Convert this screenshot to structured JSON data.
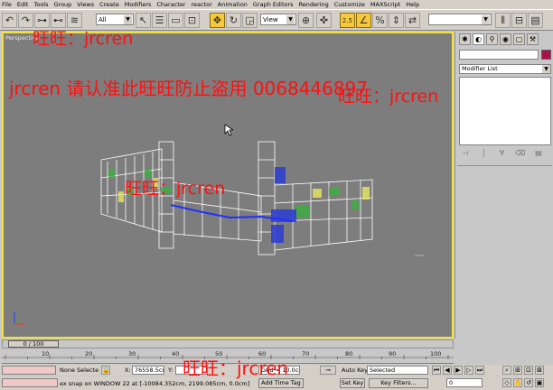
{
  "menu": [
    "File",
    "Edit",
    "Tools",
    "Group",
    "Views",
    "Create",
    "Modifiers",
    "Character",
    "reactor",
    "Animation",
    "Graph Editors",
    "Rendering",
    "Customize",
    "MAXScript",
    "Help"
  ],
  "toolbar": {
    "filter_value": "All",
    "coord_value": "View",
    "snap_label": "2.5"
  },
  "viewport": {
    "label": "Perspective"
  },
  "command_panel": {
    "modifier_list_placeholder": "Modifier List"
  },
  "timeline": {
    "frame_display": "0 / 100",
    "ticks": [
      "10",
      "20",
      "30",
      "40",
      "50",
      "60",
      "70",
      "80",
      "90",
      "100"
    ]
  },
  "status": {
    "selection": "None Selecte",
    "x_label": "X:",
    "x_value": "76558.5cm",
    "y_label": "Y:",
    "grid": "Grid = 10.0cm",
    "auto_key": "Auto Key",
    "selected": "Selected",
    "prompt": "ex snap on WINDOW 22 at [-10084.352cm, 2199.085cm, 0.0cm]",
    "add_time_tag": "Add Time Tag",
    "set_key": "Set Key",
    "key_filters": "Key Filters...",
    "frame_value": "0"
  },
  "watermarks": {
    "w1": "旺旺：jrcren",
    "w2": "jrcren 请认准此旺旺防止盗用 0068446897",
    "w3": "旺旺：jrcren",
    "w4": "旺旺：jrcren",
    "w5": "旺旺：jrcren"
  },
  "colors": {
    "accent": "#f7c93a",
    "viewport": "#7d7d7d",
    "watermark": "#ff1010",
    "object_color": "#b0104a"
  }
}
